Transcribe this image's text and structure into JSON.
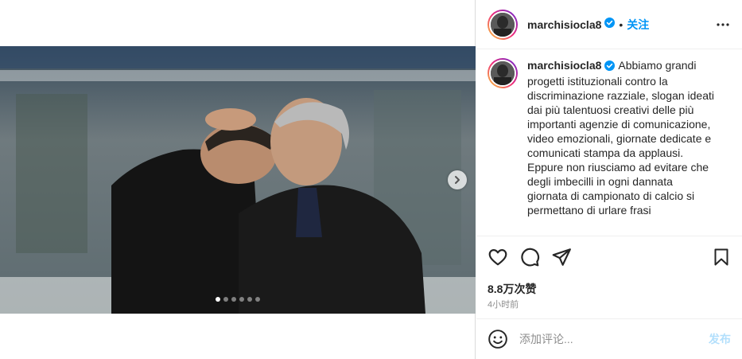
{
  "post": {
    "username": "marchisiocla8",
    "separator": "•",
    "follow_label": "关注",
    "caption": "Abbiamo grandi progetti istituzionali contro la discriminazione razziale, slogan ideati dai più talentuosi creativi delle più importanti agenzie di comunicazione, video emozionali, giornate dedicate e comunicati stampa da applausi.\nEppure non riusciamo ad evitare che degli imbecilli in ogni dannata giornata di campionato di calcio si permettano di urlare frasi",
    "likes": "8.8万次赞",
    "time": "4小时前",
    "carousel": {
      "count": 6,
      "active_index": 0
    }
  },
  "comment": {
    "placeholder": "添加评论...",
    "post_label": "发布"
  },
  "icons": {
    "verified": "verified-badge-icon",
    "more": "more-options-icon",
    "like": "heart-icon",
    "comment": "comment-icon",
    "share": "share-icon",
    "save": "bookmark-icon",
    "emoji": "emoji-icon",
    "next": "chevron-right-icon"
  },
  "colors": {
    "link": "#0095f6",
    "verified": "#0095f6",
    "post_disabled": "#b2dffc",
    "muted": "#8e8e8e"
  }
}
